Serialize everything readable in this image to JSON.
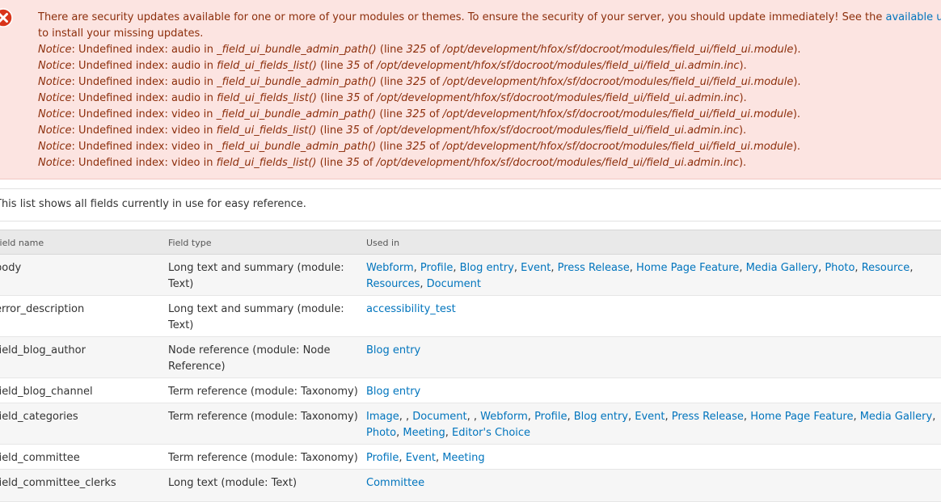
{
  "security": {
    "message": "There are security updates available for one or more of your modules or themes. To ensure the security of your server, you should update immediately! See the ",
    "link_text": "available updates",
    "message_line2": "to install your missing updates."
  },
  "notices": [
    {
      "label": "Notice",
      "text1": ": Undefined index: audio in ",
      "func": "_field_ui_bundle_admin_path()",
      "text2": " (line ",
      "line": "325",
      "text3": " of ",
      "path": "/opt/development/hfox/sf/docroot/modules/field_ui/field_ui.module",
      "end": ")."
    },
    {
      "label": "Notice",
      "text1": ": Undefined index: audio in ",
      "func": "field_ui_fields_list()",
      "text2": " (line ",
      "line": "35",
      "text3": " of ",
      "path": "/opt/development/hfox/sf/docroot/modules/field_ui/field_ui.admin.inc",
      "end": ")."
    },
    {
      "label": "Notice",
      "text1": ": Undefined index: audio in ",
      "func": "_field_ui_bundle_admin_path()",
      "text2": " (line ",
      "line": "325",
      "text3": " of ",
      "path": "/opt/development/hfox/sf/docroot/modules/field_ui/field_ui.module",
      "end": ")."
    },
    {
      "label": "Notice",
      "text1": ": Undefined index: audio in ",
      "func": "field_ui_fields_list()",
      "text2": " (line ",
      "line": "35",
      "text3": " of ",
      "path": "/opt/development/hfox/sf/docroot/modules/field_ui/field_ui.admin.inc",
      "end": ")."
    },
    {
      "label": "Notice",
      "text1": ": Undefined index: video in ",
      "func": "_field_ui_bundle_admin_path()",
      "text2": " (line ",
      "line": "325",
      "text3": " of ",
      "path": "/opt/development/hfox/sf/docroot/modules/field_ui/field_ui.module",
      "end": ")."
    },
    {
      "label": "Notice",
      "text1": ": Undefined index: video in ",
      "func": "field_ui_fields_list()",
      "text2": " (line ",
      "line": "35",
      "text3": " of ",
      "path": "/opt/development/hfox/sf/docroot/modules/field_ui/field_ui.admin.inc",
      "end": ")."
    },
    {
      "label": "Notice",
      "text1": ": Undefined index: video in ",
      "func": "_field_ui_bundle_admin_path()",
      "text2": " (line ",
      "line": "325",
      "text3": " of ",
      "path": "/opt/development/hfox/sf/docroot/modules/field_ui/field_ui.module",
      "end": ")."
    },
    {
      "label": "Notice",
      "text1": ": Undefined index: video in ",
      "func": "field_ui_fields_list()",
      "text2": " (line ",
      "line": "35",
      "text3": " of ",
      "path": "/opt/development/hfox/sf/docroot/modules/field_ui/field_ui.admin.inc",
      "end": ")."
    }
  ],
  "intro": "This list shows all fields currently in use for easy reference.",
  "table": {
    "headers": [
      "Field name",
      "Field type",
      "Used in"
    ],
    "rows": [
      {
        "name": "body",
        "type": "Long text and summary (module: Text)",
        "used": [
          [
            "Webform",
            ", "
          ],
          [
            "Profile",
            ", "
          ],
          [
            "Blog entry",
            ", "
          ],
          [
            "Event",
            ", "
          ],
          [
            "Press Release",
            ", "
          ],
          [
            "Home Page Feature",
            ", "
          ],
          [
            "Media Gallery",
            ", "
          ],
          [
            "Photo",
            ", "
          ],
          [
            "Resource",
            ", "
          ],
          [
            "Resources",
            ", "
          ],
          [
            "Document",
            ""
          ]
        ]
      },
      {
        "name": "error_description",
        "type": "Long text and summary (module: Text)",
        "used": [
          [
            "accessibility_test",
            ""
          ]
        ]
      },
      {
        "name": "field_blog_author",
        "type": "Node reference (module: Node Reference)",
        "used": [
          [
            "Blog entry",
            ""
          ]
        ]
      },
      {
        "name": "field_blog_channel",
        "type": "Term reference (module: Taxonomy)",
        "used": [
          [
            "Blog entry",
            ""
          ]
        ]
      },
      {
        "name": "field_categories",
        "type": "Term reference (module: Taxonomy)",
        "used": [
          [
            "Image",
            ", , "
          ],
          [
            "Document",
            ", , "
          ],
          [
            "Webform",
            ", "
          ],
          [
            "Profile",
            ", "
          ],
          [
            "Blog entry",
            ", "
          ],
          [
            "Event",
            ", "
          ],
          [
            "Press Release",
            ", "
          ],
          [
            "Home Page Feature",
            ", "
          ],
          [
            "Media Gallery",
            ", "
          ],
          [
            "Photo",
            ", "
          ],
          [
            "Meeting",
            ", "
          ],
          [
            "Editor's Choice",
            ""
          ]
        ]
      },
      {
        "name": "field_committee",
        "type": "Term reference (module: Taxonomy)",
        "used": [
          [
            "Profile",
            ", "
          ],
          [
            "Event",
            ", "
          ],
          [
            "Meeting",
            ""
          ]
        ]
      },
      {
        "name": "field_committee_clerks",
        "type": "Long text (module: Text)",
        "used": [
          [
            "Committee",
            ""
          ]
        ]
      }
    ]
  },
  "colors": {
    "error_bg": "#fce4e1",
    "error_text": "#8c2e0b",
    "link": "#0074bd"
  }
}
